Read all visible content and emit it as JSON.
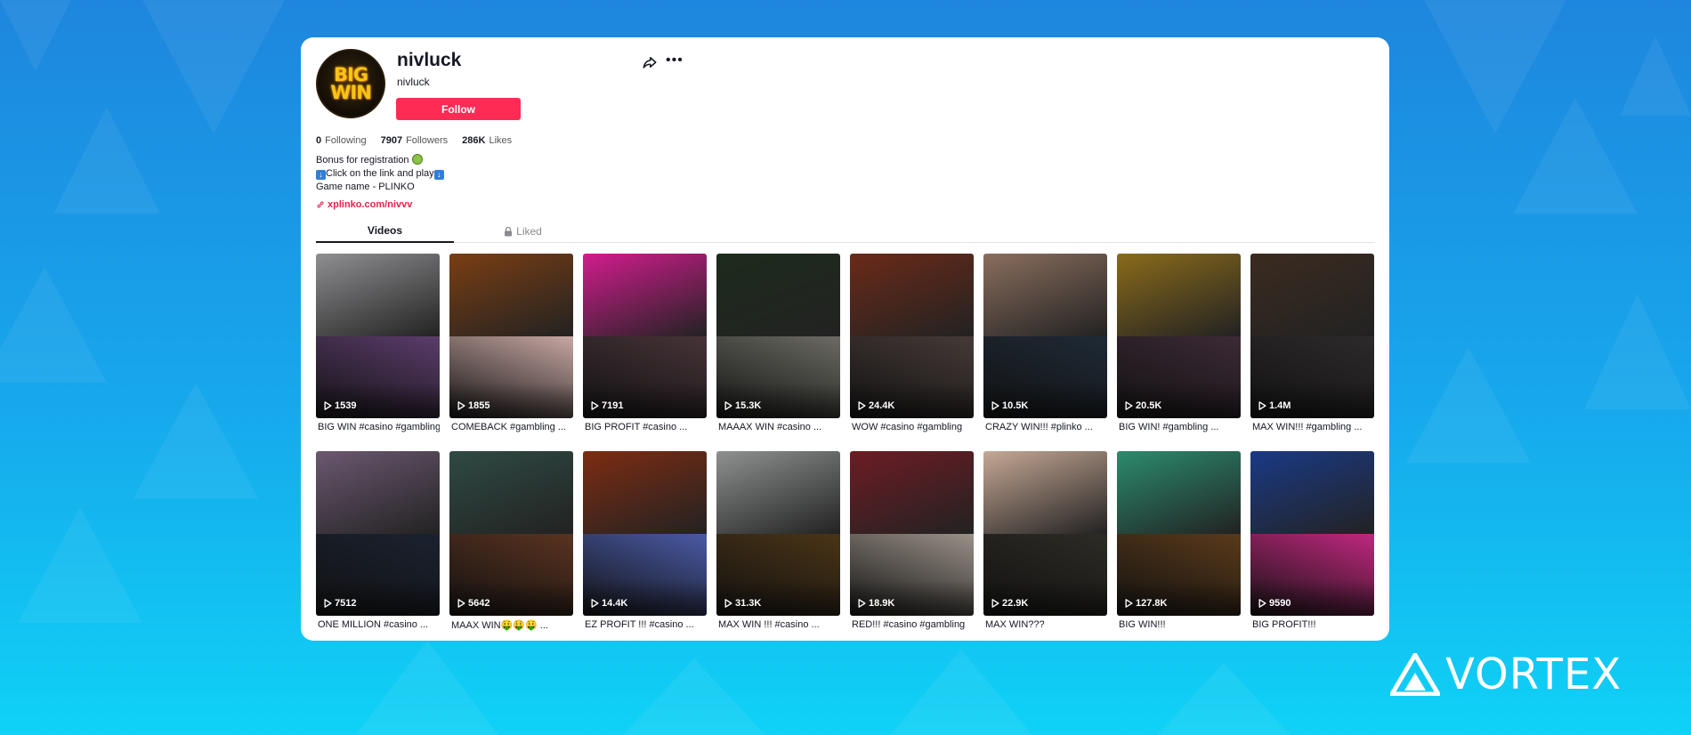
{
  "profile": {
    "username": "nivluck",
    "nickname": "nivluck",
    "avatar_text_line1": "BIG",
    "avatar_text_line2": "WIN",
    "follow_label": "Follow",
    "stats": {
      "following_count": "0",
      "following_label": "Following",
      "followers_count": "7907",
      "followers_label": "Followers",
      "likes_count": "286K",
      "likes_label": "Likes"
    },
    "bio": {
      "line1": "Bonus for registration",
      "line2_text": "Click on the link and play",
      "line3": "Game name - PLINKO"
    },
    "link": "xplinko.com/nivvv"
  },
  "tabs": {
    "videos": "Videos",
    "liked": "Liked"
  },
  "videos": [
    {
      "views": "1539",
      "caption": "BIG WIN #casino #gambling",
      "top": "#8f8f92",
      "bot": "#5b3c6b"
    },
    {
      "views": "1855",
      "caption": "COMEBACK #gambling ...",
      "top": "#7a3e13",
      "bot": "#c7a7a3"
    },
    {
      "views": "7191",
      "caption": "BIG PROFIT #casino ...",
      "top": "#d21c8e",
      "bot": "#463338"
    },
    {
      "views": "15.3K",
      "caption": "MAAAX WIN #casino ...",
      "top": "#1d2b1c",
      "bot": "#6b6b63"
    },
    {
      "views": "24.4K",
      "caption": "WOW #casino #gambling",
      "top": "#6b2a18",
      "bot": "#453a37"
    },
    {
      "views": "10.5K",
      "caption": "CRAZY WIN!!! #plinko ...",
      "top": "#8a6e5e",
      "bot": "#1f2a36"
    },
    {
      "views": "20.5K",
      "caption": "BIG WIN! #gambling ...",
      "top": "#8a6b1b",
      "bot": "#3c2a36"
    },
    {
      "views": "1.4M",
      "caption": "MAX WIN!!! #gambling ...",
      "top": "#3b2b20",
      "bot": "#2e2a2c"
    },
    {
      "views": "7512",
      "caption": "ONE MILLION #casino ...",
      "top": "#6b5870",
      "bot": "#1b2230"
    },
    {
      "views": "5642",
      "caption": "MAAX WIN🤑🤑🤑 ...",
      "top": "#2f4a43",
      "bot": "#5a3320"
    },
    {
      "views": "14.4K",
      "caption": "EZ PROFIT !!! #casino ...",
      "top": "#7d2c12",
      "bot": "#4a5aa5"
    },
    {
      "views": "31.3K",
      "caption": "MAX WIN !!! #casino ...",
      "top": "#8e9190",
      "bot": "#4a3416"
    },
    {
      "views": "18.9K",
      "caption": "RED!!! #casino #gambling",
      "top": "#6d1c24",
      "bot": "#9a9188"
    },
    {
      "views": "22.9K",
      "caption": "MAX WIN???",
      "top": "#c6a895",
      "bot": "#2d2b25"
    },
    {
      "views": "127.8K",
      "caption": "BIG WIN!!!",
      "top": "#2b8b6e",
      "bot": "#5a3a1a"
    },
    {
      "views": "9590",
      "caption": "BIG PROFIT!!!",
      "top": "#1a3a86",
      "bot": "#c0287f"
    }
  ],
  "brand": {
    "name": "VORTEX"
  },
  "colors": {
    "accent": "#fe2c55",
    "link": "#e0254c",
    "text": "#161823"
  },
  "icons": [
    "share-icon",
    "more-icon",
    "link-icon",
    "lock-icon",
    "play-icon",
    "vortex-logo-icon"
  ]
}
